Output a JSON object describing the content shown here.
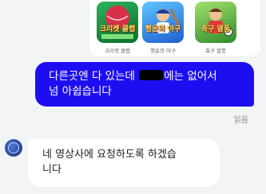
{
  "games": [
    {
      "icon": "game-thumbnail-cricket",
      "logo": "크리켓 클랩",
      "caption": "크리켓 클랩"
    },
    {
      "icon": "game-thumbnail-baseball",
      "logo": "행운의 야구",
      "caption": "행운의 야구"
    },
    {
      "icon": "game-thumbnail-soccer",
      "logo": "축구 열풍",
      "caption": "축구 열풍"
    }
  ],
  "messages": [
    {
      "direction": "outgoing",
      "line1_before": "다른곳엔 다 있는데 ",
      "line1_after": "에는 없어서",
      "line2": "넘 아쉽습니다",
      "status": "읽음"
    },
    {
      "direction": "incoming",
      "line1": "네 영상사에 요청하도록 하겠습",
      "line2": "니다"
    }
  ],
  "colors": {
    "outgoing_bubble": "#1d0ef2",
    "background": "#f3f4f6"
  }
}
